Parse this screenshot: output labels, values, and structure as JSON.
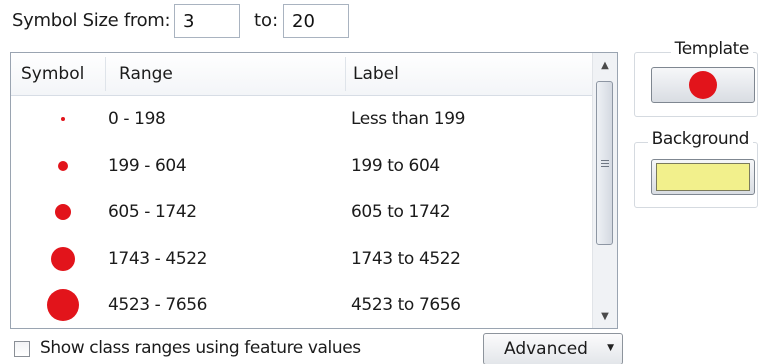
{
  "symbol_size": {
    "from_label": "Symbol Size from:",
    "from_value": "3",
    "to_label": "to:",
    "to_value": "20"
  },
  "table": {
    "columns": [
      "Symbol",
      "Range",
      "Label"
    ],
    "rows": [
      {
        "range": "0 - 198",
        "label": "Less than 199"
      },
      {
        "range": "199 - 604",
        "label": "199 to 604"
      },
      {
        "range": "605 - 1742",
        "label": "605 to 1742"
      },
      {
        "range": "1743 - 4522",
        "label": "1743 to 4522"
      },
      {
        "range": "4523 - 7656",
        "label": "4523 to 7656"
      }
    ],
    "symbol_color": "#e2141b"
  },
  "template": {
    "title": "Template",
    "color": "#e2141b"
  },
  "background": {
    "title": "Background",
    "color": "#f2f08c"
  },
  "options": {
    "show_class_ranges_label": "Show class ranges using feature values",
    "show_class_ranges_checked": false
  },
  "advanced_button": {
    "label": "Advanced"
  },
  "icons": {
    "scroll_up": "up-arrow-icon",
    "scroll_down": "down-arrow-icon",
    "dropdown": "dropdown-arrow-icon"
  }
}
